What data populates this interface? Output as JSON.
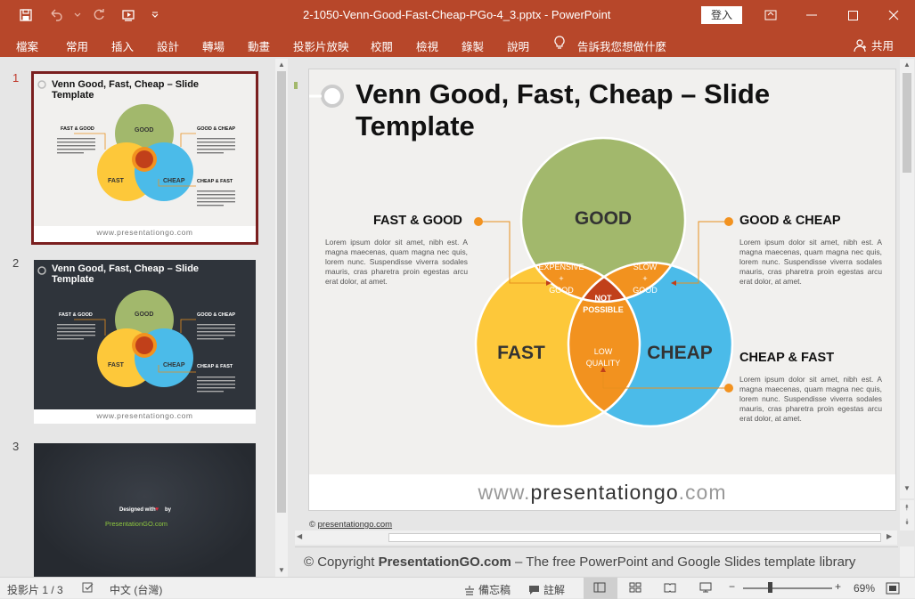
{
  "window": {
    "title": "2-1050-Venn-Good-Fast-Cheap-PGo-4_3.pptx - PowerPoint",
    "signin_label": "登入"
  },
  "ribbon": {
    "tabs": [
      "檔案",
      "常用",
      "插入",
      "設計",
      "轉場",
      "動畫",
      "投影片放映",
      "校閱",
      "檢視",
      "錄製",
      "說明"
    ],
    "tell_me": "告訴我您想做什麼",
    "share_label": "共用"
  },
  "thumbnails": [
    {
      "number": "1",
      "title": "Venn Good, Fast, Cheap – Slide Template",
      "footer": "www.presentationgo.com",
      "theme": "light"
    },
    {
      "number": "2",
      "title": "Venn Good, Fast, Cheap – Slide Template",
      "footer": "www.presentationgo.com",
      "theme": "dark"
    },
    {
      "number": "3",
      "designed_with": "Designed with",
      "by": "by",
      "brand": "PresentationGO.com",
      "theme": "dark"
    }
  ],
  "slide": {
    "title": "Venn Good, Fast, Cheap – Slide Template",
    "circles": {
      "good": "GOOD",
      "fast": "FAST",
      "cheap": "CHEAP"
    },
    "overlaps": {
      "fast_good": [
        "EXPENSIVE",
        "+",
        "GOOD"
      ],
      "good_cheap": [
        "SLOW",
        "+",
        "GOOD"
      ],
      "fast_cheap": [
        "LOW",
        "QUALITY"
      ],
      "center": [
        "NOT",
        "POSSIBLE"
      ]
    },
    "labels": {
      "fast_good": "FAST & GOOD",
      "good_cheap": "GOOD & CHEAP",
      "cheap_fast": "CHEAP & FAST"
    },
    "body_text": "Lorem ipsum dolor sit amet, nibh est. A magna maecenas, quam magna nec quis, lorem nunc. Suspendisse viverra sodales mauris, cras pharetra proin egestas arcu erat dolor, at amet.",
    "footer": {
      "www": "www.",
      "domain": "presentationgo",
      "tld": ".com"
    },
    "colors": {
      "good": "#a2b86c",
      "fast": "#fdc83a",
      "cheap": "#4bbbe9",
      "overlap": "#f2921f",
      "center": "#c1401a",
      "connector": "#e8901e"
    }
  },
  "editor": {
    "copyright_prefix": "©",
    "copyright_link": "presentationgo.com"
  },
  "notes": {
    "prefix": "© Copyright",
    "brand": "PresentationGO.com",
    "suffix": "– The free PowerPoint and Google Slides template library"
  },
  "statusbar": {
    "slide_counter": "投影片 1 / 3",
    "language": "中文 (台灣)",
    "notes_label": "備忘稿",
    "comments_label": "註解",
    "zoom_label": "69%",
    "zoom_percent": 69
  }
}
